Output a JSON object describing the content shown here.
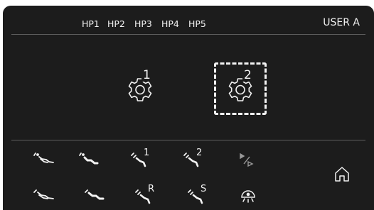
{
  "header": {
    "handpiece_tabs": [
      "HP1",
      "HP2",
      "HP3",
      "HP4",
      "HP5"
    ],
    "user_label": "USER A"
  },
  "programs": [
    {
      "number": "1",
      "selected": false,
      "icon": "gear-icon"
    },
    {
      "number": "2",
      "selected": true,
      "icon": "gear-icon"
    }
  ],
  "instruments": {
    "row1": [
      {
        "icon": "turbine-handpiece-icon",
        "label": ""
      },
      {
        "icon": "turbine-handpiece-filled-icon",
        "label": ""
      },
      {
        "icon": "scaler-icon",
        "label": "1"
      },
      {
        "icon": "scaler-icon",
        "label": "2"
      },
      {
        "icon": "forward-reverse-icon",
        "label": ""
      }
    ],
    "row2": [
      {
        "icon": "micromotor-handpiece-icon",
        "label": ""
      },
      {
        "icon": "micromotor-handpiece-filled-icon",
        "label": ""
      },
      {
        "icon": "scaler-icon",
        "label": "R"
      },
      {
        "icon": "scaler-icon",
        "label": "S"
      },
      {
        "icon": "operating-light-icon",
        "label": ""
      }
    ]
  },
  "home_icon": "home-icon",
  "colors": {
    "background": "#1c1c1c",
    "foreground": "#f2f2f2",
    "divider": "#5e5e5e"
  }
}
